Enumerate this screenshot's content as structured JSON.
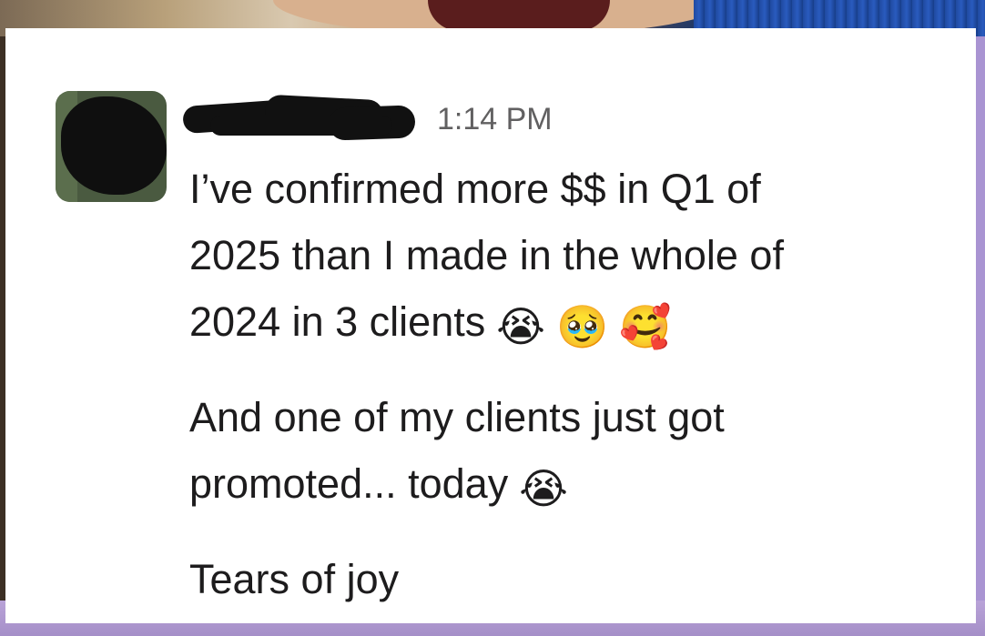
{
  "message": {
    "timestamp": "1:14 PM",
    "paragraphs": [
      {
        "lines": [
          "I’ve confirmed more $$ in Q1 of",
          "2025 than I made in the whole of",
          "2024 in 3 clients"
        ],
        "emojis": [
          "😭",
          "🥹",
          "🥰"
        ]
      },
      {
        "lines": [
          "And one of my clients just got",
          "promoted... today"
        ],
        "emojis": [
          "😭"
        ]
      },
      {
        "lines": [
          "Tears of joy"
        ],
        "emojis": []
      }
    ]
  },
  "icons": {
    "avatar": "user-avatar-redacted",
    "username": "username-redacted"
  }
}
